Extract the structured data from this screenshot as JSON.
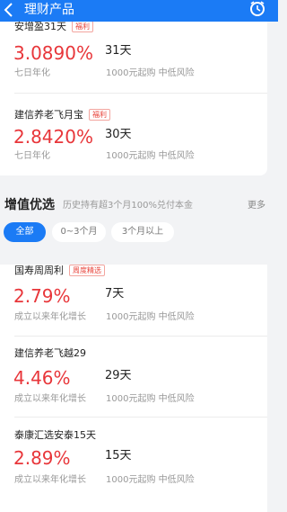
{
  "header": {
    "back_icon": "chevron-left-icon",
    "title": "理财产品",
    "clock_icon": "clock-icon",
    "bg_color": "#1b7bf5"
  },
  "top_products": [
    {
      "name": "安增盈31天",
      "tag": "福利",
      "rate": "3.0890%",
      "rate_label": "七日年化",
      "term": "31天",
      "info": "1000元起购 中低风险"
    },
    {
      "name": "建信养老飞月宝",
      "tag": "福利",
      "rate": "2.8420%",
      "rate_label": "七日年化",
      "term": "30天",
      "info": "1000元起购 中低风险"
    }
  ],
  "section": {
    "title": "增值优选",
    "subtitle": "历史持有超3个月100%兑付本金",
    "more": "更多"
  },
  "filters": {
    "all": "全部",
    "short": "0~3个月",
    "long": "3个月以上"
  },
  "products": [
    {
      "name": "国寿周周利",
      "tag": "周度精选",
      "rate": "2.79%",
      "rate_label": "成立以来年化增长",
      "term": "7天",
      "info": "1000元起购 中低风险"
    },
    {
      "name": "建信养老飞越29",
      "rate": "4.46%",
      "rate_label": "成立以来年化增长",
      "term": "29天",
      "info": "1000元起购 中低风险"
    },
    {
      "name": "泰康汇选安泰15天",
      "rate": "2.89%",
      "rate_label": "成立以来年化增长",
      "term": "15天",
      "info": "1000元起购 中低风险"
    }
  ],
  "colors": {
    "accent": "#1b7bf5",
    "rate": "#e8363a"
  }
}
